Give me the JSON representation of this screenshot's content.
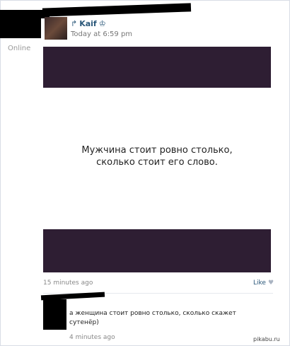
{
  "post": {
    "author": "Kaif",
    "timestamp": "Today at 6:59 pm",
    "status": "Online",
    "quote_line1": "Мужчина стоит ровно столько,",
    "quote_line2": "сколько стоит его слово.",
    "time_ago": "15 minutes ago",
    "like_label": "Like",
    "image_band_color": "#2e1e33"
  },
  "comment": {
    "text": "а женщина стоит ровно столько, сколько скажет сутенёр)",
    "time_ago": "4 minutes ago"
  },
  "watermark": "pikabu.ru",
  "icons": {
    "repost": "repost-icon",
    "crown": "crown-icon",
    "heart": "heart-icon"
  },
  "colors": {
    "link": "#2b587a",
    "meta_text": "#888888"
  }
}
